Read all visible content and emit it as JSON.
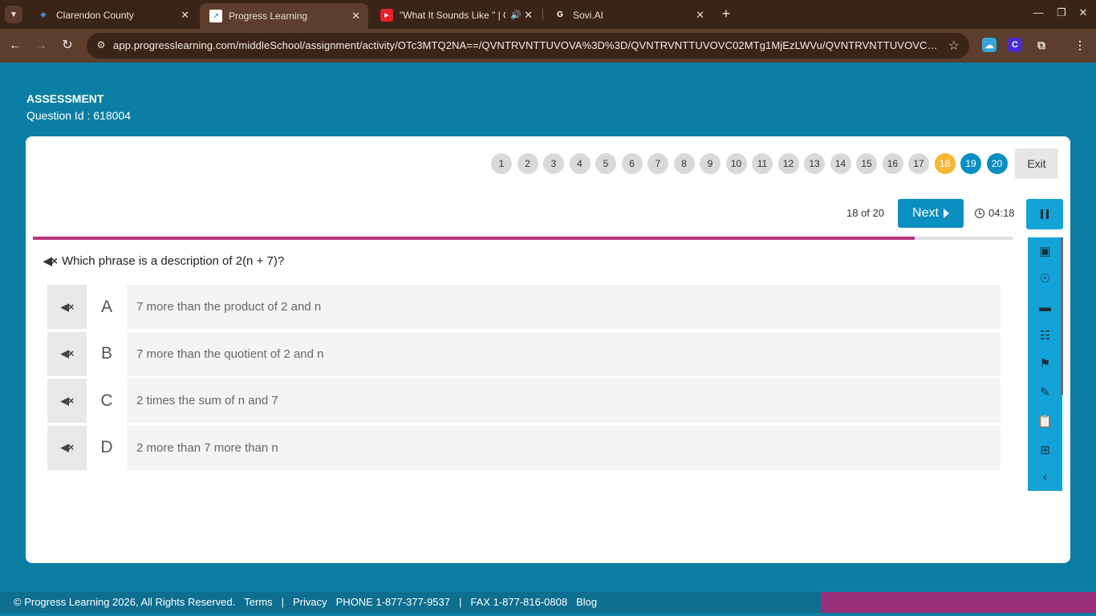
{
  "browser": {
    "tabs": [
      {
        "title": "Clarendon County",
        "active": false
      },
      {
        "title": "Progress Learning",
        "active": true
      },
      {
        "title": "\"What It Sounds Like \" | Offi",
        "active": false
      },
      {
        "title": "Sovi.AI",
        "active": false
      }
    ],
    "url": "app.progresslearning.com/middleSchool/assignment/activity/OTc3MTQ2NA==/QVNTRVNTTUVOVA%3D%3D/QVNTRVNTTUVOVC02MTg1MjEzLWVu/QVNTRVNTTUVOVC02MTg1Mj..."
  },
  "header": {
    "title": "ASSESSMENT",
    "question_id": "Question Id : 618004"
  },
  "nav": {
    "question_numbers": [
      "1",
      "2",
      "3",
      "4",
      "5",
      "6",
      "7",
      "8",
      "9",
      "10",
      "11",
      "12",
      "13",
      "14",
      "15",
      "16",
      "17",
      "18",
      "19",
      "20"
    ],
    "current": 18,
    "exit_label": "Exit",
    "progress_text": "18 of 20",
    "next_label": "Next",
    "timer": "04:18",
    "progress_fraction": 0.9
  },
  "question": {
    "text": "Which phrase is a description of 2(n + 7)?",
    "answers": [
      {
        "letter": "A",
        "text": "7 more than the product of 2 and n"
      },
      {
        "letter": "B",
        "text": "7 more than the quotient of 2 and n"
      },
      {
        "letter": "C",
        "text": "2 times the sum of n and 7"
      },
      {
        "letter": "D",
        "text": "2 more than 7 more than n"
      }
    ]
  },
  "footer": {
    "copyright": "© Progress Learning 2026, All Rights Reserved.",
    "terms": "Terms",
    "sep": "|",
    "privacy": "Privacy",
    "phone": "PHONE 1-877-377-9537",
    "fax": "FAX 1-877-816-0808",
    "blog": "Blog"
  },
  "colors": {
    "page_bg": "#0b7fa3",
    "accent": "#0b8fc1",
    "current_question": "#f7b733",
    "progress_fill": "#b8347f"
  }
}
